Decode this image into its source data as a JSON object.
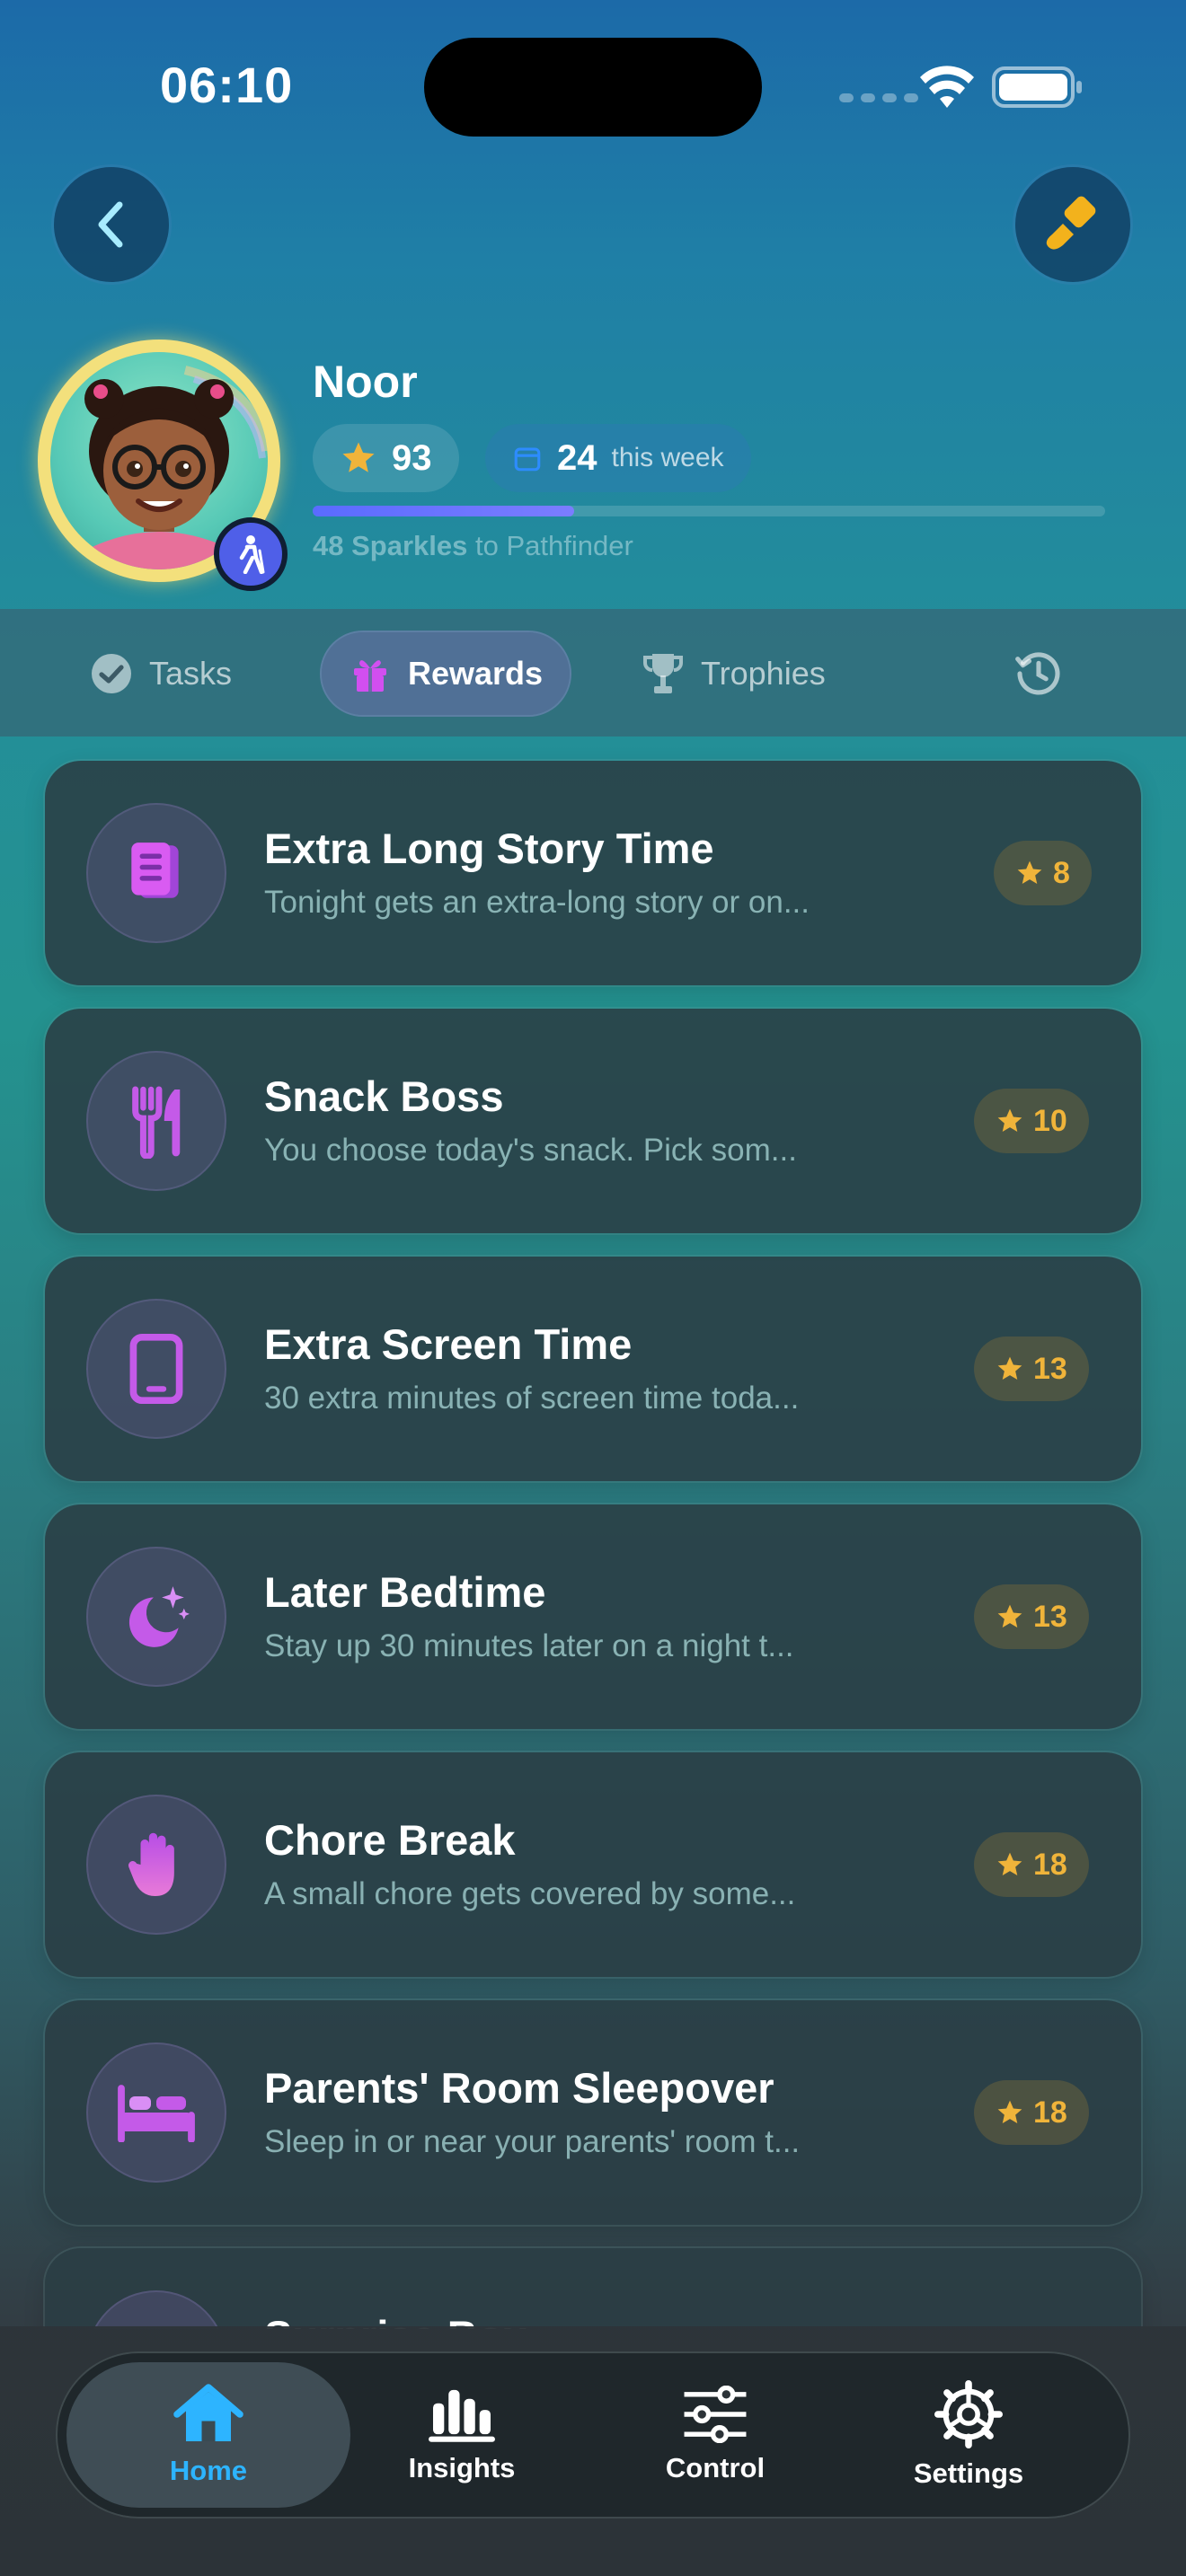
{
  "status_bar": {
    "time": "06:10"
  },
  "profile": {
    "name": "Noor",
    "stars": "93",
    "week_count": "24",
    "week_label": "this week",
    "progress_fraction": 0.33,
    "progress_value": "48 Sparkles",
    "progress_target": "to Pathfinder"
  },
  "tabs": [
    {
      "label": "Tasks",
      "icon": "check-circle-icon"
    },
    {
      "label": "Rewards",
      "icon": "gift-icon",
      "active": true
    },
    {
      "label": "Trophies",
      "icon": "trophy-icon"
    },
    {
      "label": "",
      "icon": "history-icon"
    }
  ],
  "rewards": [
    {
      "title": "Extra Long Story Time",
      "description": "Tonight gets an extra-long story or on...",
      "cost": "8",
      "icon": "book-icon"
    },
    {
      "title": "Snack Boss",
      "description": "You choose today's snack. Pick som...",
      "cost": "10",
      "icon": "fork-knife-icon"
    },
    {
      "title": "Extra Screen Time",
      "description": "30 extra minutes of screen time toda...",
      "cost": "13",
      "icon": "tablet-icon"
    },
    {
      "title": "Later Bedtime",
      "description": "Stay up 30 minutes later on a night t...",
      "cost": "13",
      "icon": "moon-stars-icon"
    },
    {
      "title": "Chore Break",
      "description": "A small chore gets covered by some...",
      "cost": "18",
      "icon": "hand-icon"
    },
    {
      "title": "Parents' Room Sleepover",
      "description": "Sleep in or near your parents' room t...",
      "cost": "18",
      "icon": "bed-icon"
    },
    {
      "title": "Surprise Box",
      "description": "",
      "cost": "",
      "icon": "gift-icon"
    }
  ],
  "nav": {
    "home": "Home",
    "insights": "Insights",
    "control": "Control",
    "settings": "Settings"
  },
  "colors": {
    "accent_star": "#f0b43a",
    "accent_nav": "#2db4ff",
    "progress": "#5a6bff",
    "icon_purple": "#c45ae8"
  }
}
